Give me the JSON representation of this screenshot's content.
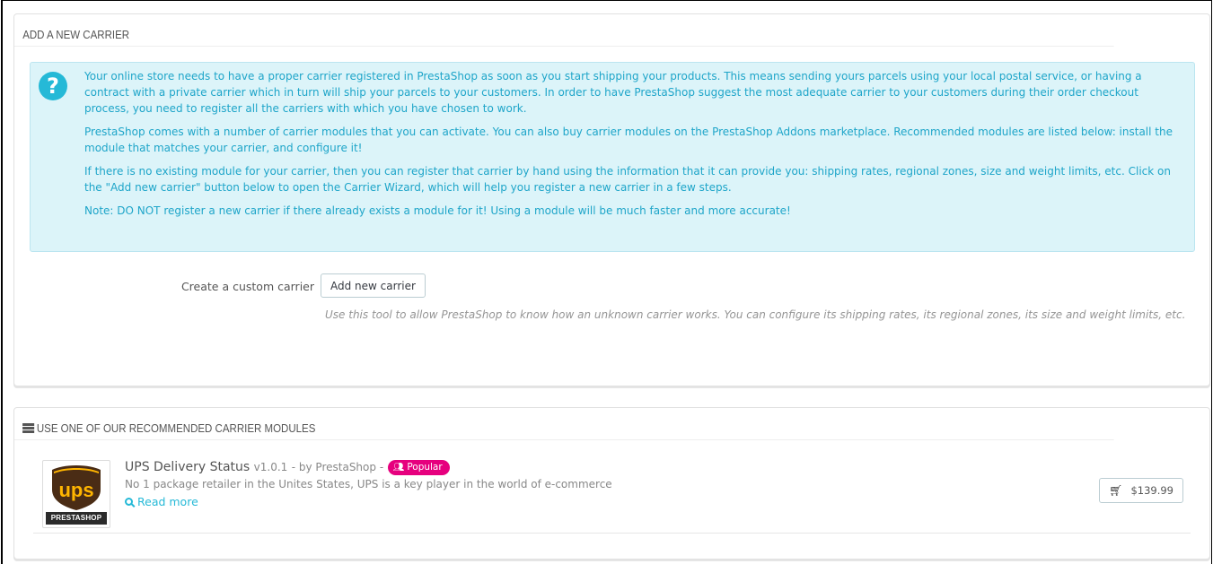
{
  "carrier_panel": {
    "title": "ADD A NEW CARRIER",
    "help_icon": "question-circle-icon",
    "paragraphs": [
      "Your online store needs to have a proper carrier registered in PrestaShop as soon as you start shipping your products. This means sending yours parcels using your local postal service, or having a contract with a private carrier which in turn will ship your parcels to your customers. In order to have PrestaShop suggest the most adequate carrier to your customers during their order checkout process, you need to register all the carriers with which you have chosen to work.",
      "PrestaShop comes with a number of carrier modules that you can activate. You can also buy carrier modules on the PrestaShop Addons marketplace. Recommended modules are listed below: install the module that matches your carrier, and configure it!",
      "If there is no existing module for your carrier, then you can register that carrier by hand using the information that it can provide you: shipping rates, regional zones, size and weight limits, etc. Click on the \"Add new carrier\" button below to open the Carrier Wizard, which will help you register a new carrier in a few steps.",
      "Note: DO NOT register a new carrier if there already exists a module for it! Using a module will be much faster and more accurate!"
    ],
    "custom_label": "Create a custom carrier",
    "add_button_label": "Add new carrier",
    "help_text": "Use this tool to allow PrestaShop to know how an unknown carrier works. You can configure its shipping rates, its regional zones, its size and weight limits, etc."
  },
  "modules_panel": {
    "title": "USE ONE OF OUR RECOMMENDED CARRIER MODULES",
    "heading_icon": "list-icon",
    "modules": [
      {
        "name": "UPS Delivery Status",
        "version": "v1.0.1",
        "author": "- by PrestaShop -",
        "badge": "Popular",
        "description": "No 1 package retailer in the Unites States, UPS is a key player in the world of e-commerce",
        "read_more": "Read more",
        "price": "$139.99",
        "logo_text": "ups",
        "logo_strip": "PRESTASHOP",
        "colors": {
          "ups_brown": "#4a2c15",
          "ups_gold": "#ffb500",
          "badge": "#e6007e"
        }
      }
    ]
  },
  "colors": {
    "info_bg": "#dcf4f9",
    "info_text": "#1ea5c9",
    "link": "#25b9d7"
  }
}
